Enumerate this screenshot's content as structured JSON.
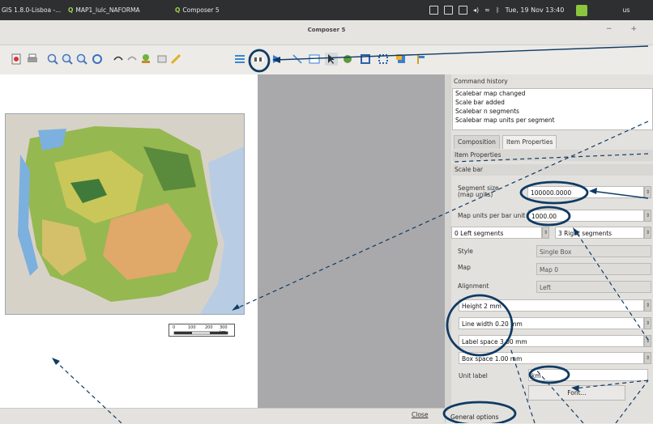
{
  "taskbar": {
    "qgis_window": "GIS 1.8.0-Lisboa -...",
    "map_window": "MAP1_lulc_NAFORMA",
    "composer_window": "Composer 5",
    "clock": "Tue, 19 Nov 13:40",
    "user": "us"
  },
  "window": {
    "title": "Composer 5",
    "controls": "− +"
  },
  "toolbar": {
    "icons": [
      "export-pdf-icon",
      "print-icon",
      "zoom-full-icon",
      "zoom-in-icon",
      "zoom-out-icon",
      "refresh-icon",
      "undo-icon",
      "redo-icon",
      "add-map-icon",
      "add-image-icon",
      "pencil-icon",
      "add-legend-icon",
      "add-scalebar-icon",
      "add-shape-icon",
      "add-arrow-icon",
      "add-table-icon",
      "select-icon",
      "move-content-icon",
      "group-icon",
      "ungroup-icon",
      "raise-icon",
      "align-icon"
    ],
    "highlight_color": "#0f3b63"
  },
  "panel": {
    "history_title": "Command history",
    "history_items": [
      "Scalebar map changed",
      "Scale bar added",
      "Scalebar n segments",
      "Scalebar map units per segment"
    ],
    "tabs": {
      "composition": "Composition",
      "item_properties": "Item Properties"
    },
    "item_properties_heading": "Item Properties",
    "scale_bar_heading": "Scale bar",
    "segment_size_label": "Segment size\n(map units)",
    "segment_size_value": "100000.0000",
    "map_units_label": "Map units per bar unit",
    "map_units_value": "1000.00",
    "left_segments": "0 Left segments",
    "right_segments": "3 Right segments",
    "style_label": "Style",
    "style_value": "Single Box",
    "map_label": "Map",
    "map_value": "Map 0",
    "alignment_label": "Alignment",
    "alignment_value": "Left",
    "height": "Height 2 mm",
    "line_width": "Line width 0.20 mm",
    "label_space": "Label space 3.00 mm",
    "box_space": "Box space 1.00 mm",
    "unit_label_label": "Unit label",
    "unit_label_value": "km",
    "font_button": "Font...",
    "general_options": "General options"
  },
  "status": {
    "close": "Close"
  },
  "scalebar": {
    "labels": [
      "0",
      "100",
      "200",
      "300 km"
    ]
  }
}
